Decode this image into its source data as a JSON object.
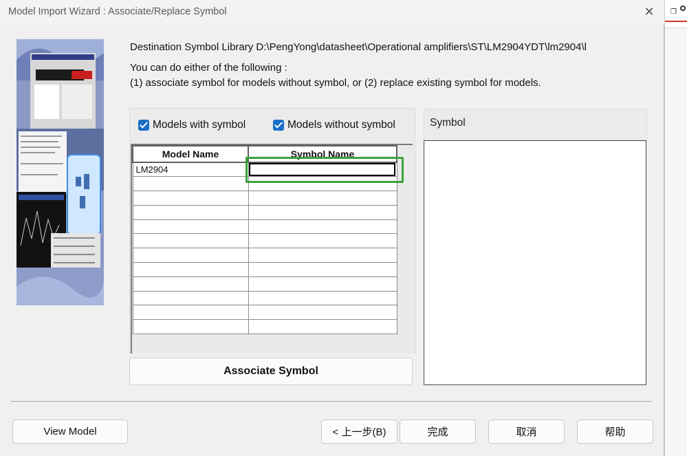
{
  "window": {
    "title": "Model Import Wizard : Associate/Replace Symbol",
    "close_glyph": "✕"
  },
  "background_app": {
    "icon_glyph": "❐"
  },
  "info": {
    "destination": "Destination Symbol Library D:\\PengYong\\datasheet\\Operational amplifiers\\ST\\LM2904YDT\\lm2904\\l",
    "instruction": "You can do either of the following :",
    "options": "(1) associate symbol for models without symbol, or (2) replace existing symbol for models."
  },
  "filters": {
    "with_symbol_label": "Models with symbol",
    "with_symbol_checked": true,
    "without_symbol_label": "Models without symbol",
    "without_symbol_checked": true
  },
  "grid": {
    "col_model": "Model Name",
    "col_symbol": "Symbol Name",
    "rows": [
      {
        "model": "LM2904",
        "symbol": ""
      },
      {
        "model": "",
        "symbol": ""
      },
      {
        "model": "",
        "symbol": ""
      },
      {
        "model": "",
        "symbol": ""
      },
      {
        "model": "",
        "symbol": ""
      },
      {
        "model": "",
        "symbol": ""
      },
      {
        "model": "",
        "symbol": ""
      },
      {
        "model": "",
        "symbol": ""
      },
      {
        "model": "",
        "symbol": ""
      },
      {
        "model": "",
        "symbol": ""
      },
      {
        "model": "",
        "symbol": ""
      },
      {
        "model": "",
        "symbol": ""
      }
    ]
  },
  "associate_button": "Associate Symbol",
  "symbol_panel": {
    "header": "Symbol"
  },
  "footer": {
    "view_model": "View Model",
    "back": "< 上一步(B)",
    "finish": "完成",
    "cancel": "取消",
    "help": "帮助"
  },
  "colors": {
    "checkbox_accent": "#1a6fc9",
    "focus_highlight": "#3aa33a",
    "dialog_bg": "#f0f0f0"
  }
}
